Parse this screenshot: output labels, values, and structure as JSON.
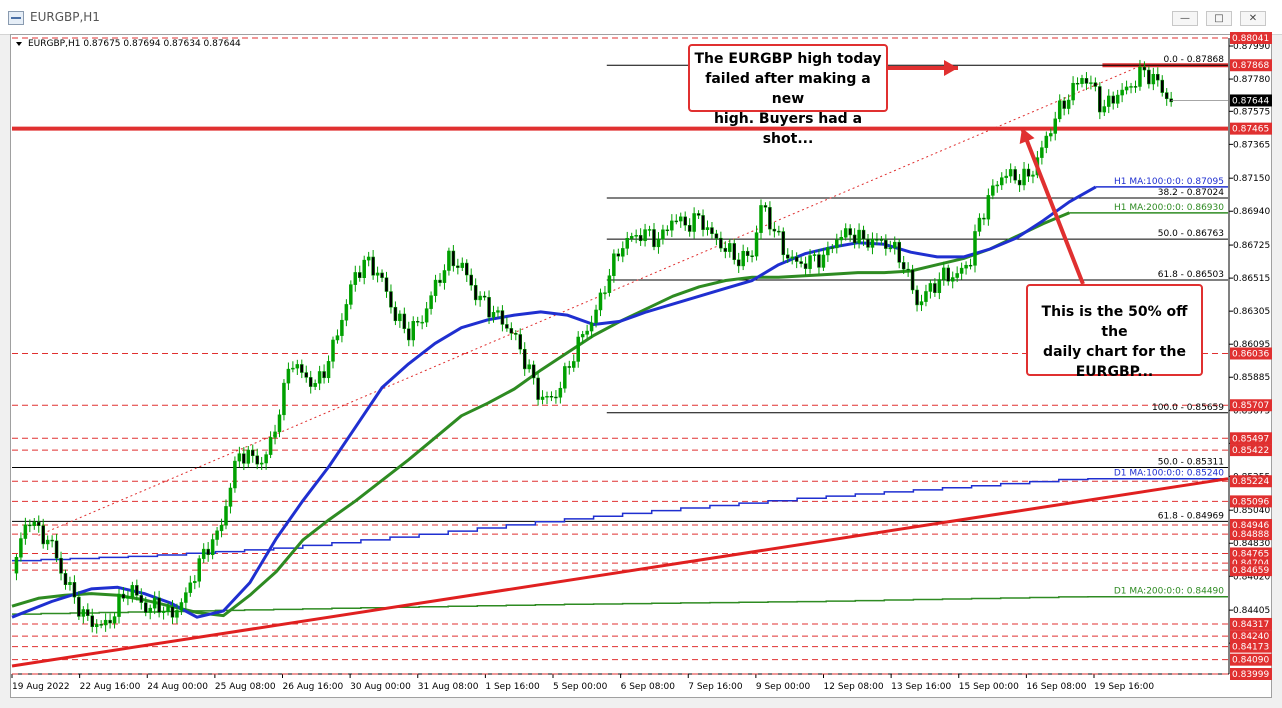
{
  "window": {
    "title": "EURGBP,H1",
    "min_glyph": "—",
    "max_glyph": "□",
    "close_glyph": "✕"
  },
  "chart_data": {
    "type": "candlestick",
    "symbol_header": "EURGBP,H1  0.87675 0.87694 0.87634 0.87644",
    "ylim": [
      0.83999,
      0.88041
    ],
    "y_ticks": [
      0.8799,
      0.8778,
      0.87575,
      0.87365,
      0.8715,
      0.8694,
      0.86725,
      0.86515,
      0.86305,
      0.86095,
      0.85885,
      0.85675,
      0.85465,
      0.85255,
      0.8504,
      0.8483,
      0.8462,
      0.84405,
      0.84195
    ],
    "x_labels": [
      "19 Aug 2022",
      "22 Aug 16:00",
      "24 Aug 00:00",
      "25 Aug 08:00",
      "26 Aug 16:00",
      "30 Aug 00:00",
      "31 Aug 08:00",
      "1 Sep 16:00",
      "5 Sep 00:00",
      "6 Sep 08:00",
      "7 Sep 16:00",
      "9 Sep 00:00",
      "12 Sep 08:00",
      "13 Sep 16:00",
      "15 Sep 00:00",
      "16 Sep 08:00",
      "19 Sep 16:00"
    ],
    "price_path": [
      [
        0,
        0.8464
      ],
      [
        0.8,
        0.8488
      ],
      [
        1.3,
        0.85
      ],
      [
        2,
        0.849
      ],
      [
        3,
        0.8483
      ],
      [
        3.7,
        0.8465
      ],
      [
        4.5,
        0.8452
      ],
      [
        5.3,
        0.8438
      ],
      [
        6,
        0.8433
      ],
      [
        7,
        0.843
      ],
      [
        7.6,
        0.8437
      ],
      [
        8.3,
        0.8448
      ],
      [
        9,
        0.8455
      ],
      [
        9.6,
        0.8447
      ],
      [
        10.3,
        0.844
      ],
      [
        11,
        0.8445
      ],
      [
        12,
        0.8436
      ],
      [
        12.5,
        0.8442
      ],
      [
        13.2,
        0.845
      ],
      [
        14,
        0.8468
      ],
      [
        15,
        0.8483
      ],
      [
        15.8,
        0.8492
      ],
      [
        16.5,
        0.852
      ],
      [
        17.2,
        0.854
      ],
      [
        18,
        0.8538
      ],
      [
        19,
        0.8534
      ],
      [
        19.5,
        0.8545
      ],
      [
        20,
        0.856
      ],
      [
        20.5,
        0.8575
      ],
      [
        21,
        0.86
      ],
      [
        22,
        0.859
      ],
      [
        23,
        0.8583
      ],
      [
        24,
        0.86
      ],
      [
        25,
        0.8627
      ],
      [
        26,
        0.8655
      ],
      [
        27,
        0.8662
      ],
      [
        28,
        0.865
      ],
      [
        29,
        0.8627
      ],
      [
        30,
        0.8617
      ],
      [
        31,
        0.8625
      ],
      [
        32,
        0.8646
      ],
      [
        33,
        0.8663
      ],
      [
        34,
        0.866
      ],
      [
        35,
        0.8642
      ],
      [
        36,
        0.8633
      ],
      [
        37,
        0.8625
      ],
      [
        38,
        0.8615
      ],
      [
        39,
        0.8595
      ],
      [
        40,
        0.8575
      ],
      [
        41,
        0.8575
      ],
      [
        42,
        0.8593
      ],
      [
        43,
        0.8613
      ],
      [
        44,
        0.8626
      ],
      [
        45,
        0.865
      ],
      [
        46,
        0.8671
      ],
      [
        47,
        0.8678
      ],
      [
        48,
        0.868
      ],
      [
        49,
        0.8675
      ],
      [
        50,
        0.869
      ],
      [
        51,
        0.8685
      ],
      [
        52,
        0.869
      ],
      [
        53,
        0.8678
      ],
      [
        54,
        0.867
      ],
      [
        55,
        0.8663
      ],
      [
        56,
        0.8667
      ],
      [
        56.7,
        0.8698
      ],
      [
        57.5,
        0.8685
      ],
      [
        58.5,
        0.8667
      ],
      [
        59.5,
        0.866
      ],
      [
        60.5,
        0.8663
      ],
      [
        61.5,
        0.8665
      ],
      [
        62.5,
        0.8678
      ],
      [
        63.5,
        0.868
      ],
      [
        64.5,
        0.8675
      ],
      [
        65.5,
        0.8675
      ],
      [
        66.5,
        0.8672
      ],
      [
        67.5,
        0.866
      ],
      [
        68.5,
        0.8635
      ],
      [
        69.5,
        0.8645
      ],
      [
        70.5,
        0.8653
      ],
      [
        71.5,
        0.8653
      ],
      [
        72.5,
        0.8663
      ],
      [
        73,
        0.8683
      ],
      [
        74,
        0.8705
      ],
      [
        75,
        0.8718
      ],
      [
        76,
        0.8715
      ],
      [
        77,
        0.8716
      ],
      [
        78,
        0.8735
      ],
      [
        79,
        0.8755
      ],
      [
        80,
        0.8768
      ],
      [
        81,
        0.878
      ],
      [
        82,
        0.877
      ],
      [
        82.5,
        0.8758
      ],
      [
        83.5,
        0.8768
      ],
      [
        84.5,
        0.8772
      ],
      [
        85.5,
        0.8783
      ],
      [
        86.5,
        0.8778
      ],
      [
        87.2,
        0.8768
      ],
      [
        87.7,
        0.87644
      ]
    ],
    "h1_ma100": [
      [
        0,
        0.8436
      ],
      [
        3,
        0.8446
      ],
      [
        6,
        0.8454
      ],
      [
        8,
        0.8455
      ],
      [
        10,
        0.8451
      ],
      [
        12,
        0.8445
      ],
      [
        14,
        0.8436
      ],
      [
        16,
        0.844
      ],
      [
        18,
        0.8458
      ],
      [
        20,
        0.8486
      ],
      [
        22,
        0.851
      ],
      [
        24,
        0.8532
      ],
      [
        26,
        0.8557
      ],
      [
        28,
        0.8582
      ],
      [
        30,
        0.8597
      ],
      [
        32,
        0.861
      ],
      [
        34,
        0.862
      ],
      [
        36,
        0.8625
      ],
      [
        38,
        0.8628
      ],
      [
        40,
        0.863
      ],
      [
        42,
        0.8628
      ],
      [
        44,
        0.8622
      ],
      [
        46,
        0.8624
      ],
      [
        48,
        0.863
      ],
      [
        50,
        0.8635
      ],
      [
        52,
        0.864
      ],
      [
        54,
        0.8645
      ],
      [
        56,
        0.865
      ],
      [
        58,
        0.866
      ],
      [
        60,
        0.8667
      ],
      [
        62,
        0.8671
      ],
      [
        64,
        0.8674
      ],
      [
        66,
        0.8673
      ],
      [
        68,
        0.8668
      ],
      [
        70,
        0.8665
      ],
      [
        72,
        0.8665
      ],
      [
        74,
        0.867
      ],
      [
        76,
        0.8677
      ],
      [
        78,
        0.8688
      ],
      [
        80,
        0.87
      ],
      [
        82,
        0.87095
      ]
    ],
    "h1_ma200": [
      [
        0,
        0.8443
      ],
      [
        2,
        0.8448
      ],
      [
        4,
        0.845
      ],
      [
        6,
        0.8451
      ],
      [
        8,
        0.845
      ],
      [
        10,
        0.8447
      ],
      [
        12,
        0.8443
      ],
      [
        14,
        0.8439
      ],
      [
        16,
        0.8437
      ],
      [
        18,
        0.845
      ],
      [
        20,
        0.8465
      ],
      [
        22,
        0.8485
      ],
      [
        24,
        0.8498
      ],
      [
        26,
        0.851
      ],
      [
        28,
        0.8523
      ],
      [
        30,
        0.8536
      ],
      [
        32,
        0.855
      ],
      [
        34,
        0.8564
      ],
      [
        36,
        0.8572
      ],
      [
        38,
        0.8581
      ],
      [
        40,
        0.8593
      ],
      [
        42,
        0.8604
      ],
      [
        44,
        0.8615
      ],
      [
        46,
        0.8624
      ],
      [
        48,
        0.8632
      ],
      [
        50,
        0.864
      ],
      [
        52,
        0.8646
      ],
      [
        54,
        0.865
      ],
      [
        56,
        0.8652
      ],
      [
        58,
        0.8652
      ],
      [
        60,
        0.8653
      ],
      [
        62,
        0.8654
      ],
      [
        64,
        0.8655
      ],
      [
        66,
        0.8655
      ],
      [
        68,
        0.8656
      ],
      [
        70,
        0.866
      ],
      [
        72,
        0.8664
      ],
      [
        74,
        0.867
      ],
      [
        76,
        0.8678
      ],
      [
        78,
        0.8686
      ],
      [
        80,
        0.8693
      ]
    ],
    "d1_ma100": [
      [
        0,
        0.8472
      ],
      [
        10,
        0.8475
      ],
      [
        20,
        0.848
      ],
      [
        30,
        0.8488
      ],
      [
        40,
        0.8497
      ],
      [
        50,
        0.8505
      ],
      [
        60,
        0.8512
      ],
      [
        70,
        0.8518
      ],
      [
        80,
        0.8524
      ],
      [
        92,
        0.8524
      ]
    ],
    "d1_ma200": [
      [
        0,
        0.8438
      ],
      [
        20,
        0.8441
      ],
      [
        40,
        0.8444
      ],
      [
        60,
        0.8446
      ],
      [
        80,
        0.8449
      ],
      [
        92,
        0.8449
      ]
    ],
    "trendline": [
      [
        0,
        0.8405
      ],
      [
        92,
        0.8524
      ]
    ],
    "horizontal_levels": [
      {
        "price": 0.87465,
        "label": "0.87465",
        "style": "thick-red"
      },
      {
        "price": 0.87868,
        "label": "0.87868",
        "style": "thick-red-right"
      },
      {
        "price": 0.88041,
        "label": "0.88041",
        "style": "red-dash"
      },
      {
        "price": 0.86036,
        "label": "0.86036",
        "style": "red-dash"
      },
      {
        "price": 0.85707,
        "label": "0.85707",
        "style": "red-dash"
      },
      {
        "price": 0.85497,
        "label": "0.85497",
        "style": "red-dash"
      },
      {
        "price": 0.85422,
        "label": "0.85422",
        "style": "red-dash"
      },
      {
        "price": 0.85224,
        "label": "0.85224",
        "style": "red-dash"
      },
      {
        "price": 0.85096,
        "label": "0.85096",
        "style": "red-dash"
      },
      {
        "price": 0.84946,
        "label": "0.84946",
        "style": "red-dash"
      },
      {
        "price": 0.84888,
        "label": "0.84888",
        "style": "red-dash"
      },
      {
        "price": 0.84765,
        "label": "0.84765",
        "style": "red-dash"
      },
      {
        "price": 0.84704,
        "label": "0.84704",
        "style": "red-dash"
      },
      {
        "price": 0.84659,
        "label": "0.84659",
        "style": "red-dash"
      },
      {
        "price": 0.84317,
        "label": "0.84317",
        "style": "red-dash"
      },
      {
        "price": 0.8424,
        "label": "0.84240",
        "style": "red-dash"
      },
      {
        "price": 0.84173,
        "label": "0.84173",
        "style": "red-dash"
      },
      {
        "price": 0.8409,
        "label": "0.84090",
        "style": "red-dash"
      },
      {
        "price": 0.83999,
        "label": "0.83999",
        "style": "red-dash"
      }
    ],
    "current_price": {
      "price": 0.87644,
      "label": "0.87644"
    },
    "fib_near": [
      {
        "price": 0.87868,
        "label": "0.0 - 0.87868"
      },
      {
        "price": 0.87024,
        "label": "38.2 - 0.87024"
      },
      {
        "price": 0.86763,
        "label": "50.0 - 0.86763"
      },
      {
        "price": 0.86503,
        "label": "61.8 - 0.86503"
      },
      {
        "price": 0.85659,
        "label": "100.0 - 0.85659"
      }
    ],
    "fib_daily": [
      {
        "price": 0.85311,
        "label": "50.0 - 0.85311"
      },
      {
        "price": 0.84969,
        "label": "61.8 - 0.84969"
      }
    ],
    "ma_labels": {
      "h1_ma100": "H1 MA:100:0:0: 0.87095",
      "h1_ma200": "H1 MA:200:0:0: 0.86930",
      "d1_ma100": "D1 MA:100:0:0: 0.85240",
      "d1_ma200": "D1 MA:200:0:0: 0.84490"
    },
    "colors": {
      "candle": "#00a000",
      "h1_ma100": "#1f2fd0",
      "h1_ma200": "#2e8b22",
      "d1_ma100": "#1f2fd0",
      "d1_ma200": "#2e8b22",
      "trendline": "#e02020",
      "level": "#e03030",
      "fib": "#000000"
    },
    "annotations": [
      {
        "text_lines": [
          "The EURGBP high today",
          "failed after making a new",
          "high.  Buyers had a shot..."
        ]
      },
      {
        "text_lines": [
          "This is the 50% off the",
          "daily chart for the",
          "EURGBP..."
        ]
      }
    ]
  }
}
